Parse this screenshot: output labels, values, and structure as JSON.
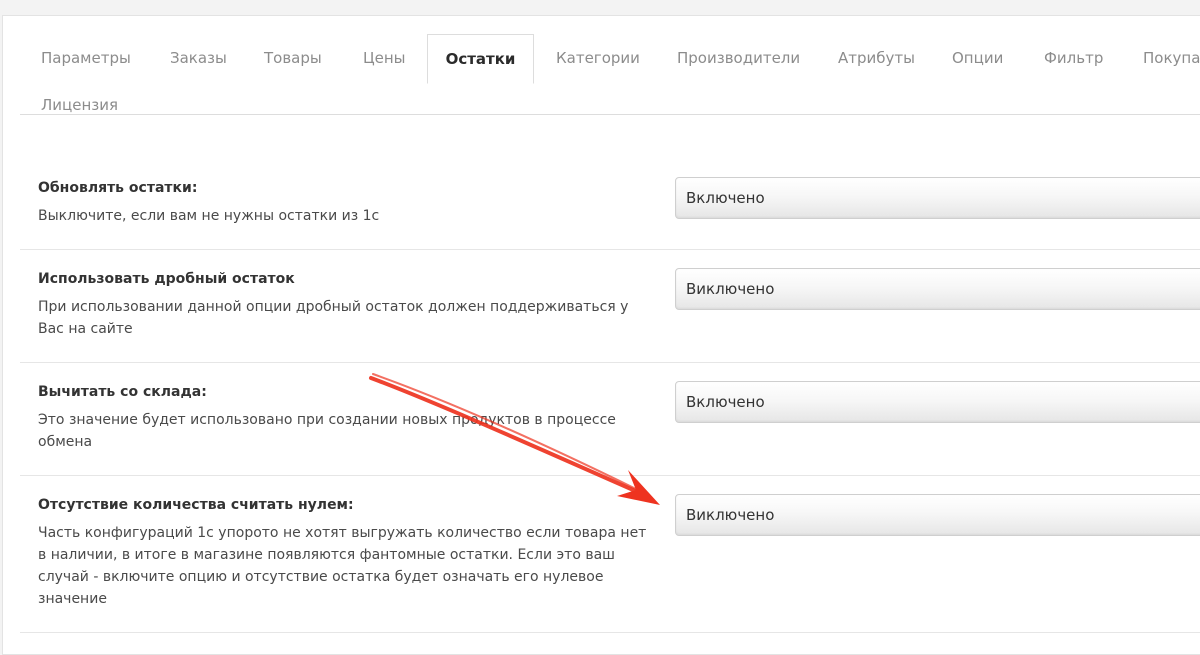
{
  "tabs": [
    {
      "label": "Параметры",
      "active": false
    },
    {
      "label": "Заказы",
      "active": false
    },
    {
      "label": "Товары",
      "active": false
    },
    {
      "label": "Цены",
      "active": false
    },
    {
      "label": "Остатки",
      "active": true
    },
    {
      "label": "Категории",
      "active": false
    },
    {
      "label": "Производители",
      "active": false
    },
    {
      "label": "Атрибуты",
      "active": false
    },
    {
      "label": "Опции",
      "active": false
    },
    {
      "label": "Фильтр",
      "active": false
    },
    {
      "label": "Покупат",
      "active": false
    },
    {
      "label": "Лицензия",
      "active": false
    }
  ],
  "settings": [
    {
      "title": "Обновлять остатки:",
      "description": "Выключите, если вам не нужны остатки из 1с",
      "value": "Включено"
    },
    {
      "title": "Использовать дробный остаток",
      "description": "При использовании данной опции дробный остаток должен поддерживаться у Вас на сайте",
      "value": "Виключено"
    },
    {
      "title": "Вычитать со склада:",
      "description": "Это значение будет использовано при создании новых продуктов в процессе обмена",
      "value": "Включено"
    },
    {
      "title": "Отсутствие количества считать нулем:",
      "description": "Часть конфигураций 1с упорото не хотят выгружать количество если товара нет в наличии, в итоге в магазине появляются фантомные остатки. Если это ваш случай - включите опцию и отсутствие остатка будет означать его нулевое значение",
      "value": "Виключено"
    }
  ],
  "colors": {
    "annotation_arrow": "#ee3320",
    "active_tab_text": "#2b2b2b",
    "inactive_tab_text": "#8c8c8c"
  },
  "annotation": {
    "icon": "red-arrow-icon",
    "points_to": "settings.3.value"
  }
}
